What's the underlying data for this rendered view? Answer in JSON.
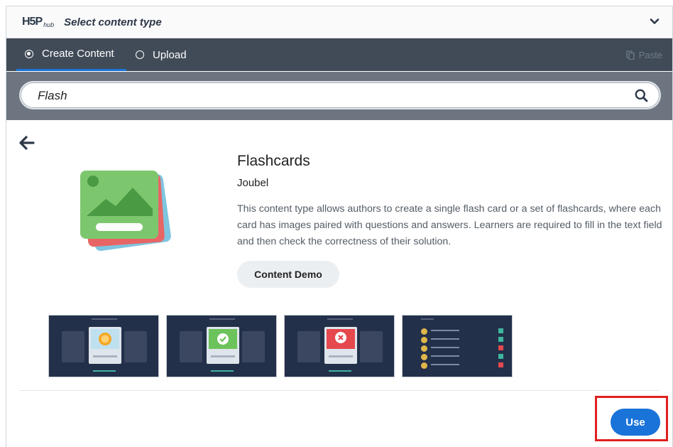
{
  "header": {
    "logo_text": "H5P",
    "logo_suffix": "hub",
    "title": "Select content type",
    "chevron_icon": "chevron-down-icon"
  },
  "tabs": [
    {
      "label": "Create Content",
      "selected": true
    },
    {
      "label": "Upload",
      "selected": false
    }
  ],
  "paste": {
    "label": "Paste",
    "icon": "paste-icon",
    "enabled": false
  },
  "search": {
    "value": "Flash",
    "icon": "search-icon"
  },
  "detail": {
    "back_icon": "arrow-left-icon",
    "title": "Flashcards",
    "owner": "Joubel",
    "description": "This content type allows authors to create a single flash card or a set of flashcards, where each card has images paired with questions and answers. Learners are required to fill in the text field and then check the correctness of their solution.",
    "demo_label": "Content Demo",
    "screenshots": [
      "screenshot-1",
      "screenshot-2",
      "screenshot-3",
      "screenshot-4"
    ],
    "use_label": "Use"
  },
  "colors": {
    "accent": "#1a73d9",
    "tabs_bg": "#414b58",
    "search_bg": "#6d7581",
    "highlight": "#e0201f"
  }
}
